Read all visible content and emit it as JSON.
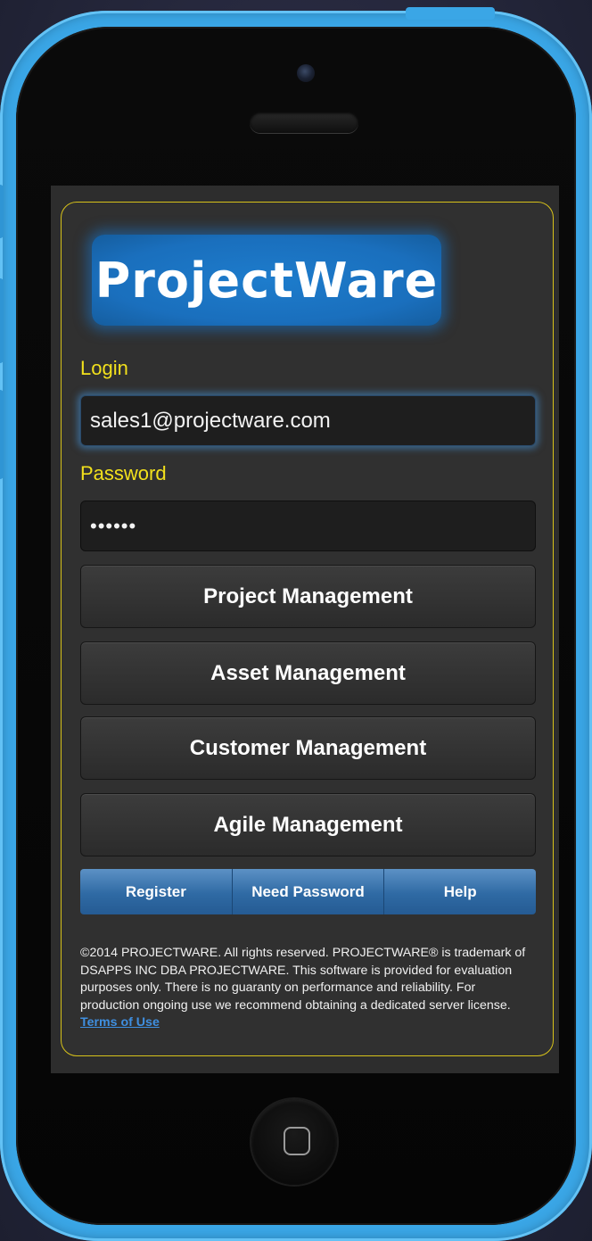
{
  "logo": {
    "text": "ProjectWare"
  },
  "login": {
    "label": "Login",
    "value": "sales1@projectware.com"
  },
  "password": {
    "label": "Password",
    "value": "••••••"
  },
  "modules": [
    {
      "label": "Project Management"
    },
    {
      "label": "Asset Management"
    },
    {
      "label": "Customer Management"
    },
    {
      "label": "Agile Management"
    }
  ],
  "tabs": [
    {
      "label": "Register"
    },
    {
      "label": "Need Password"
    },
    {
      "label": "Help"
    }
  ],
  "footer": {
    "text": "©2014 PROJECTWARE. All rights reserved. PROJECTWARE® is trademark of DSAPPS INC DBA PROJECTWARE. This software is provided for evaluation purposes only. There is no guaranty on performance and reliability. For production ongoing use we recommend obtaining a dedicated server license.",
    "link": "Terms of Use"
  },
  "colors": {
    "accent": "#f2e01c",
    "phone_frame": "#3aa6e6",
    "logo_bg": "#1a6fbd",
    "tab_bg": "#2f6aa4"
  }
}
